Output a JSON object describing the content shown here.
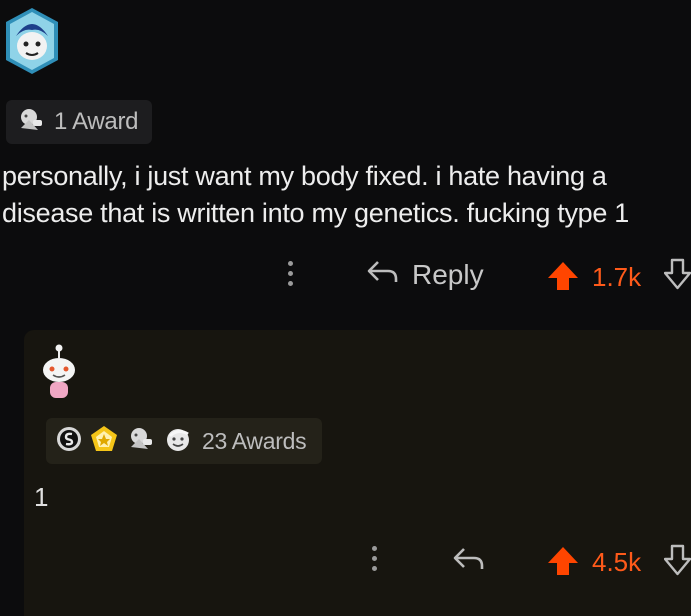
{
  "comment": {
    "award_label": "1 Award",
    "body": "personally, i just want my body fixed. i hate having a disease that is written into my genetics. fucking type 1",
    "reply_label": "Reply",
    "vote_count": "1.7k"
  },
  "reply": {
    "awards_label": "23 Awards",
    "body": "1",
    "vote_count": "4.5k"
  },
  "colors": {
    "background": "#0c0c0d",
    "card": "#17150f",
    "upvote": "#ff4500"
  }
}
